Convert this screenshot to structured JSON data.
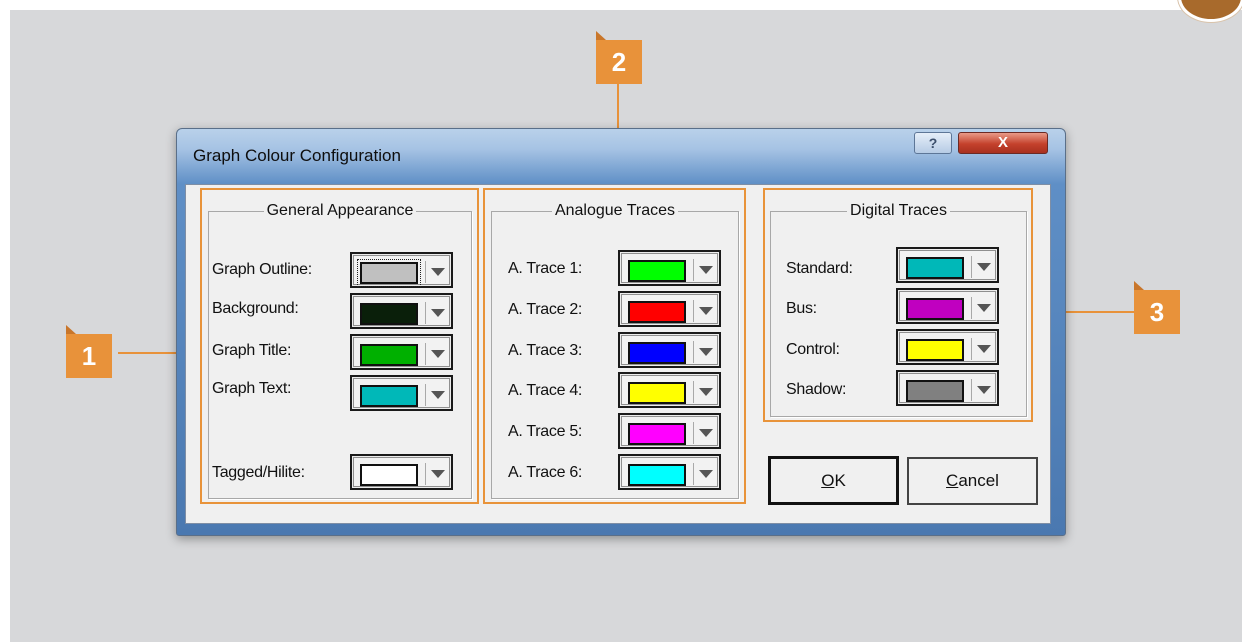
{
  "window": {
    "title": "Graph Colour Configuration",
    "help_label": "?",
    "close_label": "X"
  },
  "groups": {
    "general": {
      "legend": "General Appearance",
      "items": [
        {
          "label": "Graph Outline:",
          "color": "#c0c0c0"
        },
        {
          "label": "Background:",
          "color": "#0a1f0a"
        },
        {
          "label": "Graph Title:",
          "color": "#00b000"
        },
        {
          "label": "Graph Text:",
          "color": "#00b8b8"
        },
        {
          "label": "Tagged/Hilite:",
          "color": "#ffffff"
        }
      ]
    },
    "analogue": {
      "legend": "Analogue Traces",
      "items": [
        {
          "label": "A. Trace 1:",
          "color": "#00ff00"
        },
        {
          "label": "A. Trace 2:",
          "color": "#ff0000"
        },
        {
          "label": "A. Trace 3:",
          "color": "#0000ff"
        },
        {
          "label": "A. Trace 4:",
          "color": "#ffff00"
        },
        {
          "label": "A. Trace 5:",
          "color": "#ff00ff"
        },
        {
          "label": "A. Trace 6:",
          "color": "#00ffff"
        }
      ]
    },
    "digital": {
      "legend": "Digital Traces",
      "items": [
        {
          "label": "Standard:",
          "color": "#00b8b8"
        },
        {
          "label": "Bus:",
          "color": "#c000c0"
        },
        {
          "label": "Control:",
          "color": "#ffff00"
        },
        {
          "label": "Shadow:",
          "color": "#808080"
        }
      ]
    }
  },
  "buttons": {
    "ok": {
      "mnemonic": "O",
      "rest": "K"
    },
    "cancel": {
      "mnemonic": "C",
      "rest": "ancel"
    }
  },
  "callouts": [
    "1",
    "2",
    "3"
  ],
  "accent_color": "#e8923a"
}
